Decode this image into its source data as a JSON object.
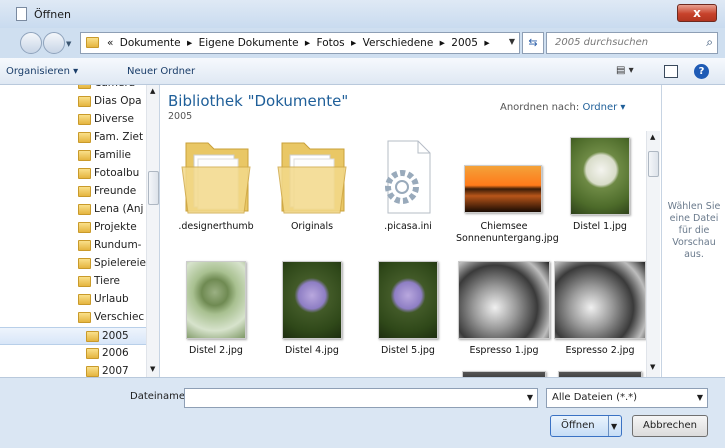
{
  "window": {
    "title": "Öffnen",
    "close_label": "x"
  },
  "address": {
    "crumbs": [
      "«",
      "Dokumente",
      "▸",
      "Eigene Dokumente",
      "▸",
      "Fotos",
      "▸",
      "Verschiedene",
      "▸",
      "2005",
      "▸"
    ],
    "search_placeholder": "2005 durchsuchen"
  },
  "toolbar": {
    "organize": "Organisieren ▾",
    "new_folder": "Neuer Ordner",
    "help": "?"
  },
  "tree": [
    {
      "label": "Camera"
    },
    {
      "label": "Dias Opa"
    },
    {
      "label": "Diverse"
    },
    {
      "label": "Fam. Ziet"
    },
    {
      "label": "Familie"
    },
    {
      "label": "Fotoalbu"
    },
    {
      "label": "Freunde"
    },
    {
      "label": "Lena (Anj"
    },
    {
      "label": "Projekte"
    },
    {
      "label": "Rundum-"
    },
    {
      "label": "Spielereie"
    },
    {
      "label": "Tiere"
    },
    {
      "label": "Urlaub"
    },
    {
      "label": "Verschiec"
    },
    {
      "label": "2005",
      "sub": true,
      "selected": true
    },
    {
      "label": "2006",
      "sub": true
    },
    {
      "label": "2007",
      "sub": true
    }
  ],
  "library": {
    "title": "Bibliothek \"Dokumente\"",
    "subtitle": "2005",
    "arrange_label": "Anordnen nach:",
    "arrange_value": "Ordner ▾"
  },
  "files": [
    {
      "name": ".designerthumb",
      "kind": "folder"
    },
    {
      "name": "Originals",
      "kind": "folder"
    },
    {
      "name": ".picasa.ini",
      "kind": "ini"
    },
    {
      "name": "Chiemsee Sonnenuntergang.jpg",
      "kind": "sunset"
    },
    {
      "name": "Distel 1.jpg",
      "kind": "white-thistle"
    },
    {
      "name": "Distel 2.jpg",
      "kind": "green-thistle"
    },
    {
      "name": "Distel 4.jpg",
      "kind": "purple-thistle"
    },
    {
      "name": "Distel 5.jpg",
      "kind": "purple-thistle"
    },
    {
      "name": "Espresso 1.jpg",
      "kind": "bw"
    },
    {
      "name": "Espresso 2.jpg",
      "kind": "bw"
    }
  ],
  "preview": {
    "text": "Wählen Sie eine Datei für die Vorschau aus."
  },
  "bottom": {
    "filename_label": "Dateiname:",
    "filename_value": "",
    "filetype": "Alle Dateien (*.*)",
    "open": "Öffnen",
    "cancel": "Abbrechen"
  },
  "colors": {
    "accent": "#1f5f99",
    "selection": "#d8e6f8",
    "frame": "#cfdff0"
  }
}
